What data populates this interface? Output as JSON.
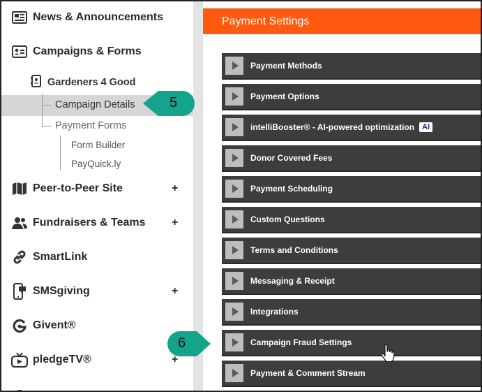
{
  "sidebar": {
    "news": {
      "label": "News & Announcements",
      "icon": "newspaper-icon"
    },
    "campaigns": {
      "label": "Campaigns & Forms",
      "icon": "id-card-icon"
    },
    "org": {
      "label": "Gardeners 4 Good",
      "icon": "address-book-icon"
    },
    "campaign_details": "Campaign Details",
    "payment_forms": "Payment Forms",
    "form_builder": "Form Builder",
    "payquick": "PayQuick.ly",
    "peer": {
      "label": "Peer-to-Peer Site",
      "icon": "map-icon",
      "plus": "+"
    },
    "fundraisers": {
      "label": "Fundraisers & Teams",
      "icon": "users-icon",
      "plus": "+"
    },
    "smartlink": {
      "label": "SmartLink",
      "icon": "link-icon"
    },
    "smsgiving": {
      "label": "SMSgiving",
      "icon": "phone-chat-icon",
      "plus": "+"
    },
    "givent": {
      "label": "Givent®",
      "icon": "givent-icon"
    },
    "pledgetv": {
      "label": "pledgeTV®",
      "icon": "tv-icon",
      "plus": "+"
    }
  },
  "main": {
    "title": "Payment Settings",
    "sections": [
      "Payment Methods",
      "Payment Options",
      "intelliBooster® - AI-powered optimization",
      "Donor Covered Fees",
      "Payment Scheduling",
      "Custom Questions",
      "Terms and Conditions",
      "Messaging & Receipt",
      "Integrations",
      "Campaign Fraud Settings",
      "Payment & Comment Stream"
    ],
    "ai_badge": "AI"
  },
  "callouts": {
    "step5": "5",
    "step6": "6"
  },
  "colors": {
    "header": "#ff5a10",
    "accordion": "#3d3d3d",
    "callout": "#14a38b",
    "active": "#d6d6d6"
  }
}
